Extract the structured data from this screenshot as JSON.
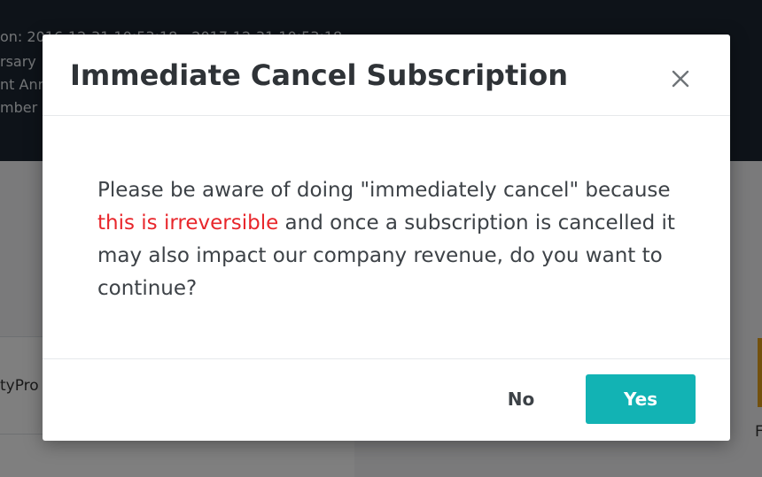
{
  "background": {
    "header_lines": [
      "on:  2016-12-31 10:53:18 - 2017-12-31 10:53:18",
      "rsary",
      "nt Ann",
      "mber"
    ],
    "card_row_text": "tyPro",
    "right_text": "F"
  },
  "modal": {
    "title": "Immediate Cancel Subscription",
    "close_icon": "close-icon",
    "message": {
      "part1": "Please be aware of doing \"immediately cancel\" because ",
      "warning": "this is irreversible",
      "part2": " and once a subscription is cancelled it may also impact our company revenue, do you want to continue?"
    },
    "buttons": {
      "no_label": "No",
      "yes_label": "Yes"
    }
  },
  "colors": {
    "accent": "#12b3b4",
    "warning": "#e8262b",
    "header_bg": "#1c2733"
  }
}
